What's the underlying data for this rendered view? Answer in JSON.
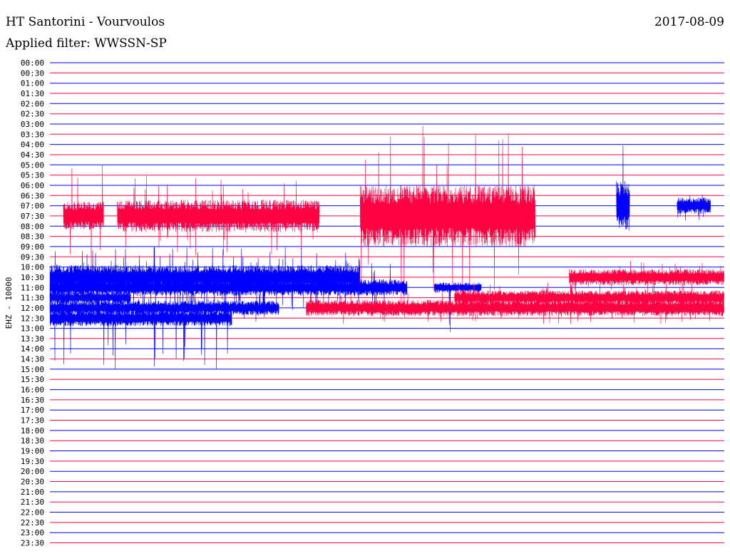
{
  "header": {
    "title": "HT Santorini - Vourvoulos",
    "filter": "Applied filter: WWSSN-SP",
    "date": "2017-08-09"
  },
  "chart_data": {
    "type": "line",
    "ylabel": "EHZ - 10000",
    "trace_colors": [
      "#0000ff",
      "#ff0040"
    ],
    "time_labels": [
      "00:00",
      "00:30",
      "01:00",
      "01:30",
      "02:00",
      "02:30",
      "03:00",
      "03:30",
      "04:00",
      "04:30",
      "05:00",
      "05:30",
      "06:00",
      "06:30",
      "07:00",
      "07:30",
      "08:00",
      "08:30",
      "09:00",
      "09:30",
      "10:00",
      "10:30",
      "11:00",
      "11:30",
      "12:00",
      "12:30",
      "13:00",
      "13:30",
      "14:00",
      "14:30",
      "15:00",
      "15:30",
      "16:00",
      "16:30",
      "17:00",
      "17:30",
      "18:00",
      "18:30",
      "19:00",
      "19:30",
      "20:00",
      "20:30",
      "21:00",
      "21:30",
      "22:00",
      "22:30",
      "23:00",
      "23:30"
    ],
    "bursts": [
      {
        "color": "red",
        "row": 15,
        "t0": 0.02,
        "t1": 0.08,
        "amp": 1.4,
        "spike": 6.0
      },
      {
        "color": "red",
        "row": 15,
        "t0": 0.1,
        "t1": 0.4,
        "amp": 1.6,
        "spike": 4.0
      },
      {
        "color": "red",
        "row": 15,
        "t0": 0.46,
        "t1": 0.72,
        "amp": 3.0,
        "spike": 9.0
      },
      {
        "color": "blue",
        "row": 14,
        "t0": 0.84,
        "t1": 0.86,
        "amp": 2.5,
        "spike": 9.0
      },
      {
        "color": "blue",
        "row": 14,
        "t0": 0.93,
        "t1": 0.98,
        "amp": 0.8,
        "spike": 1.5
      },
      {
        "color": "blue",
        "row": 21,
        "t0": 0.0,
        "t1": 0.46,
        "amp": 1.2,
        "spike": 3.0
      },
      {
        "color": "blue",
        "row": 22,
        "t0": 0.0,
        "t1": 0.53,
        "amp": 0.8,
        "spike": 2.5
      },
      {
        "color": "blue",
        "row": 22,
        "t0": 0.57,
        "t1": 0.64,
        "amp": 0.5,
        "spike": 4.5
      },
      {
        "color": "blue",
        "row": 23,
        "t0": 0.0,
        "t1": 0.12,
        "amp": 0.6,
        "spike": 1.5
      },
      {
        "color": "blue",
        "row": 24,
        "t0": 0.0,
        "t1": 0.34,
        "amp": 0.7,
        "spike": 1.5
      },
      {
        "color": "blue",
        "row": 25,
        "t0": 0.0,
        "t1": 0.27,
        "amp": 0.8,
        "spike": 5.0
      },
      {
        "color": "red",
        "row": 24,
        "t0": 0.38,
        "t1": 1.0,
        "amp": 0.8,
        "spike": 1.6
      },
      {
        "color": "red",
        "row": 23,
        "t0": 0.6,
        "t1": 1.0,
        "amp": 0.7,
        "spike": 1.5
      },
      {
        "color": "red",
        "row": 21,
        "t0": 0.77,
        "t1": 1.0,
        "amp": 0.8,
        "spike": 1.6
      }
    ]
  }
}
